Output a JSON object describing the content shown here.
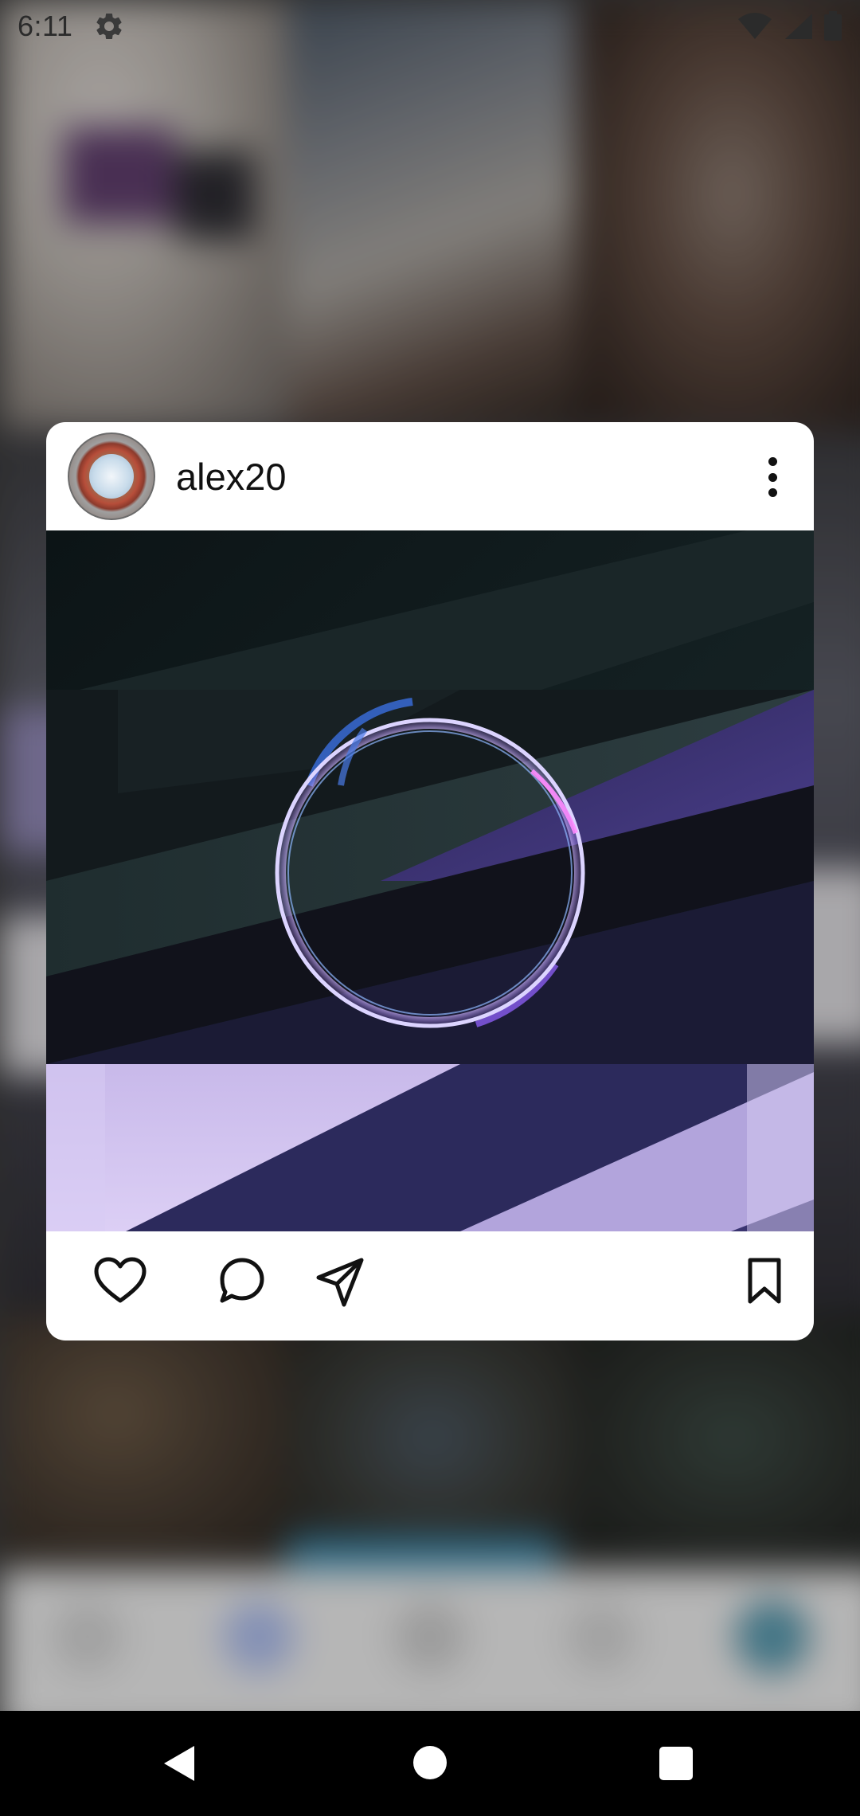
{
  "status_bar": {
    "time": "6:11",
    "icons": [
      "gear-icon",
      "wifi-icon",
      "signal-icon",
      "battery-icon"
    ]
  },
  "post": {
    "username": "alex20",
    "avatar": "avatar",
    "menu_icon": "more-vertical-icon",
    "actions": [
      "heart-icon",
      "comment-icon",
      "send-icon",
      "bookmark-icon"
    ]
  },
  "background": {
    "screen": "explore-grid",
    "nav_icons": [
      "home-icon",
      "search-icon",
      "add-icon",
      "activity-icon",
      "profile-avatar"
    ]
  },
  "system_nav": {
    "buttons": [
      "back-button",
      "home-button",
      "recents-button"
    ]
  },
  "colors": {
    "card_background": "#ffffff",
    "icon_color": "#111111",
    "system_nav_background": "#000000"
  }
}
